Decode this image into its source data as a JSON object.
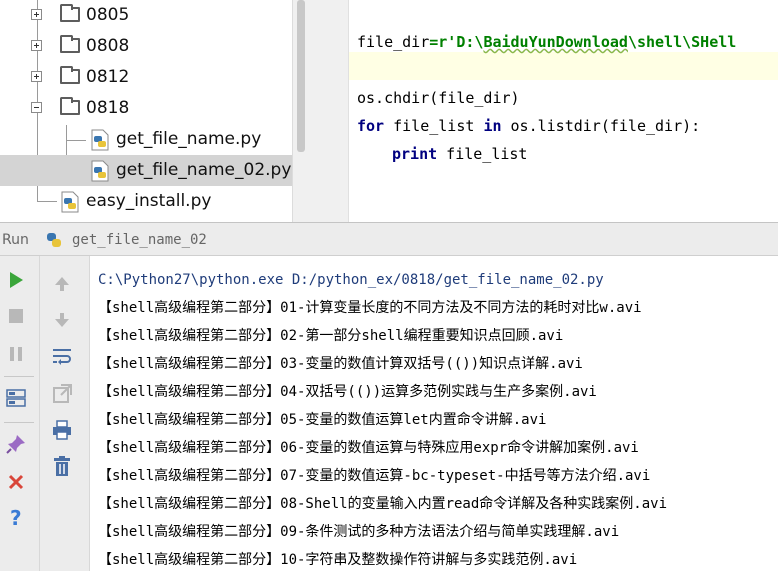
{
  "project_tree": {
    "items": [
      {
        "label": "0805",
        "kind": "folder",
        "expanded": false
      },
      {
        "label": "0808",
        "kind": "folder",
        "expanded": false
      },
      {
        "label": "0812",
        "kind": "folder",
        "expanded": false
      },
      {
        "label": "0818",
        "kind": "folder",
        "expanded": true
      },
      {
        "label": "get_file_name.py",
        "kind": "python-file"
      },
      {
        "label": "get_file_name_02.py",
        "kind": "python-file",
        "selected": true
      },
      {
        "label": "easy_install.py",
        "kind": "python-file"
      }
    ]
  },
  "editor": {
    "line1": {
      "var": "file_dir",
      "op": "=r'",
      "path_a": "D:\\",
      "path_typo": "BaiduYunDownload",
      "path_b": "\\shell\\SHell"
    },
    "line3": "os.chdir(file_dir)",
    "line4": {
      "kw_for": "for",
      "var": " file_list ",
      "kw_in": "in",
      "rest": " os.listdir(file_dir):"
    },
    "line5": {
      "kw_print": "print",
      "rest": " file_list"
    }
  },
  "run": {
    "title": "Run",
    "tab_label": "get_file_name_02"
  },
  "console": {
    "command": "C:\\Python27\\python.exe D:/python_ex/0818/get_file_name_02.py",
    "lines": [
      "【shell高级编程第二部分】01-计算变量长度的不同方法及不同方法的耗时对比w.avi",
      "【shell高级编程第二部分】02-第一部分shell编程重要知识点回顾.avi",
      "【shell高级编程第二部分】03-变量的数值计算双括号(())知识点详解.avi",
      "【shell高级编程第二部分】04-双括号(())运算多范例实践与生产多案例.avi",
      "【shell高级编程第二部分】05-变量的数值运算let内置命令讲解.avi",
      "【shell高级编程第二部分】06-变量的数值运算与特殊应用expr命令讲解加案例.avi",
      "【shell高级编程第二部分】07-变量的数值运算-bc-typeset-中括号等方法介绍.avi",
      "【shell高级编程第二部分】08-Shell的变量输入内置read命令详解及各种实践案例.avi",
      "【shell高级编程第二部分】09-条件测试的多种方法语法介绍与简单实践理解.avi",
      "【shell高级编程第二部分】10-字符串及整数操作符讲解与多实践范例.avi"
    ]
  },
  "icons": {
    "run": "play-icon",
    "stop": "stop-icon",
    "pause": "pause-icon",
    "layout": "layout-icon",
    "pin": "pin-icon",
    "close": "close-icon",
    "help": "help-icon",
    "up": "arrow-up-icon",
    "down": "arrow-down-icon",
    "wrap": "soft-wrap-icon",
    "export": "export-icon",
    "print": "print-icon",
    "trash": "trash-icon"
  },
  "colors": {
    "run_green": "#3aa53a",
    "close_red": "#d9463a",
    "help_blue": "#3a7bd5",
    "keyword": "#000080",
    "string": "#008000"
  }
}
